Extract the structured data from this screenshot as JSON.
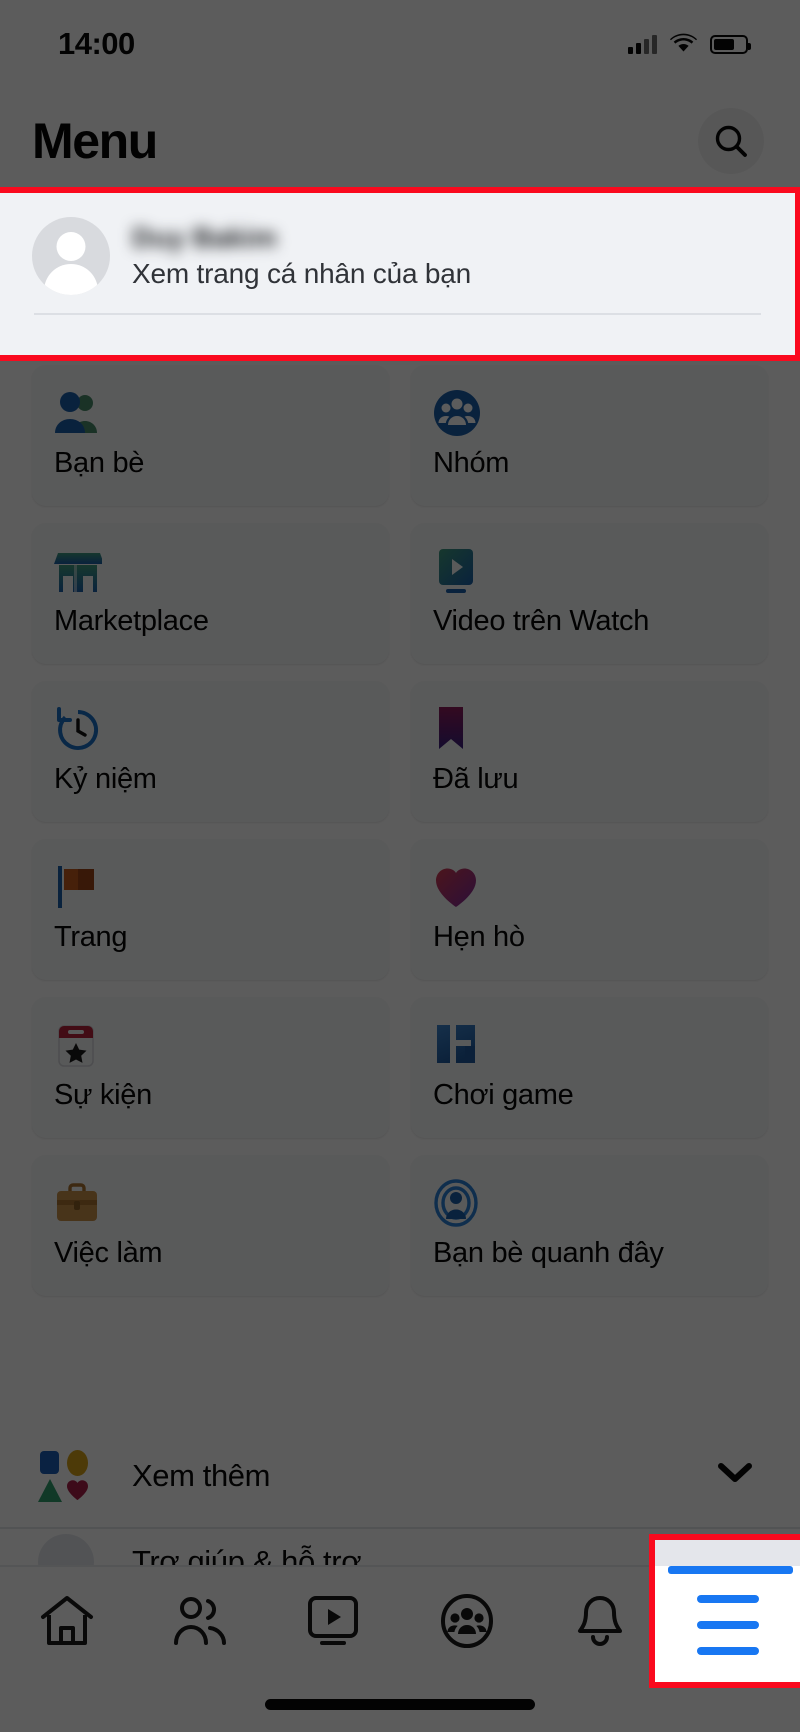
{
  "status_bar": {
    "time": "14:00",
    "cellular_icon": "cellular-signal-icon",
    "wifi_icon": "wifi-icon",
    "battery_icon": "battery-icon"
  },
  "header": {
    "title": "Menu",
    "search_icon": "search-icon"
  },
  "profile": {
    "name": "",
    "subtitle": "Xem trang cá nhân của bạn",
    "avatar_icon": "avatar-placeholder-icon"
  },
  "menu_grid": [
    {
      "label": "Bạn bè",
      "icon": "friends-icon"
    },
    {
      "label": "Nhóm",
      "icon": "groups-icon"
    },
    {
      "label": "Marketplace",
      "icon": "marketplace-icon"
    },
    {
      "label": "Video trên Watch",
      "icon": "watch-video-icon"
    },
    {
      "label": "Kỷ niệm",
      "icon": "memories-clock-icon"
    },
    {
      "label": "Đã lưu",
      "icon": "saved-bookmark-icon"
    },
    {
      "label": "Trang",
      "icon": "pages-flag-icon"
    },
    {
      "label": "Hẹn hò",
      "icon": "dating-heart-icon"
    },
    {
      "label": "Sự kiện",
      "icon": "events-calendar-icon"
    },
    {
      "label": "Chơi game",
      "icon": "gaming-icon"
    },
    {
      "label": "Việc làm",
      "icon": "jobs-briefcase-icon"
    },
    {
      "label": "Bạn bè quanh đây",
      "icon": "nearby-friends-icon"
    }
  ],
  "see_more": {
    "label": "Xem thêm",
    "icon": "shapes-icon",
    "chevron_icon": "chevron-down-icon"
  },
  "next_row": {
    "label": "Trợ giúp & hỗ trợ",
    "icon": "help-icon"
  },
  "bottom_nav": [
    {
      "label": "Trang chủ",
      "icon": "home-icon",
      "active": false
    },
    {
      "label": "Bạn bè",
      "icon": "friends-nav-icon",
      "active": false
    },
    {
      "label": "Watch",
      "icon": "watch-nav-icon",
      "active": false
    },
    {
      "label": "Nhóm",
      "icon": "groups-nav-icon",
      "active": false
    },
    {
      "label": "Thông báo",
      "icon": "bell-icon",
      "active": false
    },
    {
      "label": "Menu",
      "icon": "hamburger-menu-icon",
      "active": true
    }
  ],
  "annotations": {
    "highlight_color": "#fa0a1e",
    "highlighted_items": [
      "profile-row",
      "menu-nav-tab"
    ]
  },
  "colors": {
    "accent": "#1877f2",
    "tile_background": "#f7f8fa",
    "profile_background": "#f0f2f5",
    "text": "#080808"
  }
}
